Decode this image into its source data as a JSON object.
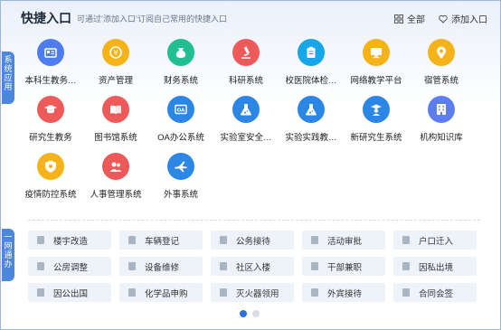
{
  "header": {
    "title": "快捷入口",
    "subtitle": "可通过‘添加入口’订阅自己常用的快捷入口",
    "all_label": "全部",
    "add_label": "添加入口"
  },
  "side_tabs": [
    "系统应用",
    "一网通办"
  ],
  "apps": [
    {
      "label": "本科生教务…",
      "icon": "id-card-icon",
      "color": "#4d7df0"
    },
    {
      "label": "资产管理",
      "icon": "coin-icon",
      "color": "#f5b319"
    },
    {
      "label": "财务系统",
      "icon": "money-bag-icon",
      "color": "#1fbf8f"
    },
    {
      "label": "科研系统",
      "icon": "microscope-icon",
      "color": "#ee5a5a"
    },
    {
      "label": "校医院体检…",
      "icon": "clipboard-icon",
      "color": "#17a6e8"
    },
    {
      "label": "网络教学平台",
      "icon": "monitor-icon",
      "color": "#f5b319"
    },
    {
      "label": "宿管系统",
      "icon": "location-icon",
      "color": "#f5b319"
    },
    {
      "label": "研究生教务",
      "icon": "graduation-cap-icon",
      "color": "#ee5a5a"
    },
    {
      "label": "图书馆系统",
      "icon": "book-icon",
      "color": "#ee5a5a"
    },
    {
      "label": "OA办公系统",
      "icon": "oa-icon",
      "color": "#2c86e6"
    },
    {
      "label": "实验室安全…",
      "icon": "flask-icon",
      "color": "#2c86e6"
    },
    {
      "label": "实验实践教…",
      "icon": "flask-icon",
      "color": "#2c86e6"
    },
    {
      "label": "新研究生系统",
      "icon": "graduate-icon",
      "color": "#2c86e6"
    },
    {
      "label": "机构知识库",
      "icon": "building-icon",
      "color": "#5b7df0"
    },
    {
      "label": "疫情防控系统",
      "icon": "shield-icon",
      "color": "#f5b319"
    },
    {
      "label": "人事管理系统",
      "icon": "people-icon",
      "color": "#ee5a5a"
    },
    {
      "label": "外事系统",
      "icon": "airplane-icon",
      "color": "#2c86e6"
    }
  ],
  "quick_links": [
    "楼宇改造",
    "车辆登记",
    "公务接待",
    "活动审批",
    "户口迁入",
    "公房调整",
    "设备维修",
    "社区入楼",
    "干部兼职",
    "因私出境",
    "因公出国",
    "化学品申购",
    "灭火器领用",
    "外宾接待",
    "合同会签"
  ],
  "pagination": {
    "pages": 2,
    "current": 1
  }
}
